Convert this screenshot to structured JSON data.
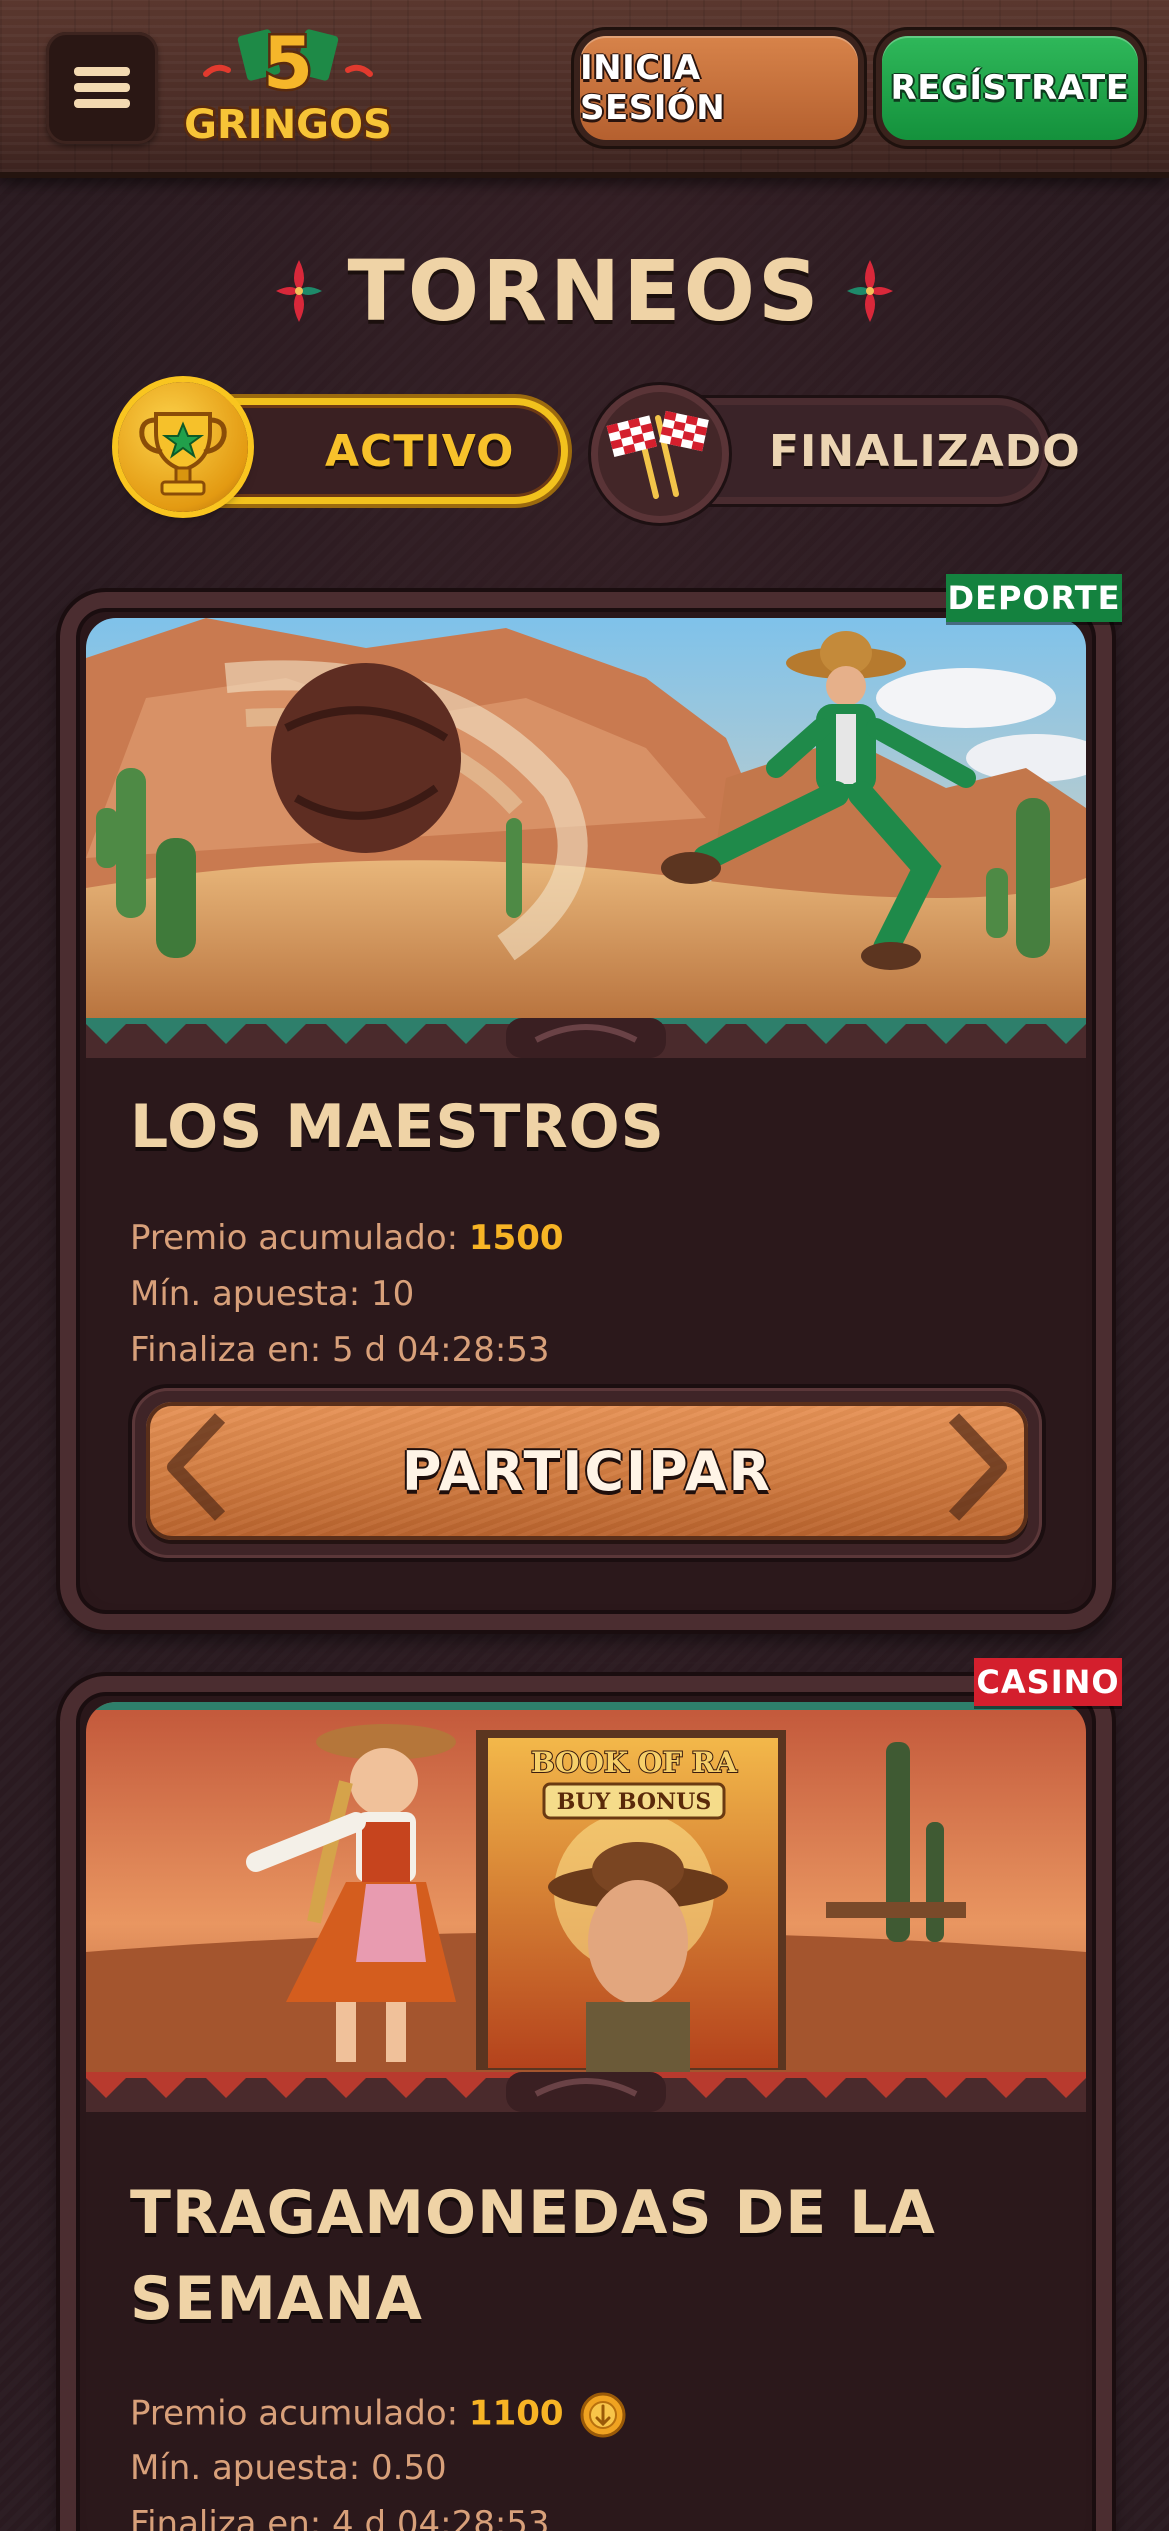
{
  "header": {
    "logo_number": "5",
    "logo_text": "GRINGOS",
    "login_label": "INICIA SESIÓN",
    "register_label": "REGÍSTRATE"
  },
  "page": {
    "title": "TORNEOS"
  },
  "tabs": [
    {
      "label": "ACTIVO",
      "active": true
    },
    {
      "label": "FINALIZADO",
      "active": false
    }
  ],
  "tournaments": [
    {
      "category": "DEPORTE",
      "category_color": "#14823f",
      "title": "LOS MAESTROS",
      "prize_label": "Premio acumulado:",
      "prize_value": "1500",
      "min_bet_label": "Mín. apuesta:",
      "min_bet_value": "10",
      "ends_label": "Finaliza en:",
      "ends_value": "5 d 04:28:53",
      "cta_label": "PARTICIPAR"
    },
    {
      "category": "CASINO",
      "category_color": "#d41f2d",
      "title": "TRAGAMONEDAS DE LA SEMANA",
      "prize_label": "Premio acumulado:",
      "prize_value": "1100",
      "min_bet_label": "Mín. apuesta:",
      "min_bet_value": "0.50",
      "ends_label": "Finaliza en:",
      "ends_value": "4 d 04:28:53",
      "game_logo_text": "BOOK OF RA",
      "game_badge_text": "BUY BONUS"
    }
  ],
  "colors": {
    "accent_gold": "#f7c22b",
    "text_cream": "#efd3a6",
    "info_text": "#d8a07a",
    "button_orange": "#d07b40",
    "button_green": "#14913c"
  }
}
